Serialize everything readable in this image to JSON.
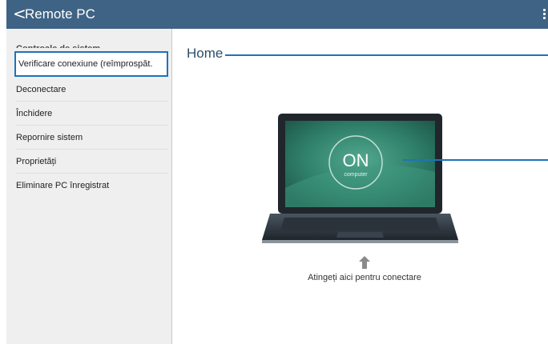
{
  "header": {
    "back_glyph": "<",
    "title": "Remote PC"
  },
  "sidebar": {
    "section_title": "Controale de sistem",
    "items": [
      {
        "label": "Verificare conexiune (reîmprospăt."
      },
      {
        "label": "Deconectare"
      },
      {
        "label": "Închidere"
      },
      {
        "label": "Repornire sistem"
      },
      {
        "label": "Proprietăți"
      },
      {
        "label": "Eliminare PC înregistrat"
      }
    ]
  },
  "main": {
    "home_label": "Home",
    "screen_status": "ON",
    "screen_sub": "computer",
    "tap_label": "Atingeți aici pentru conectare"
  },
  "colors": {
    "topbar": "#3f6384",
    "accent": "#1e73b8",
    "screen": "#2f7f6a"
  }
}
